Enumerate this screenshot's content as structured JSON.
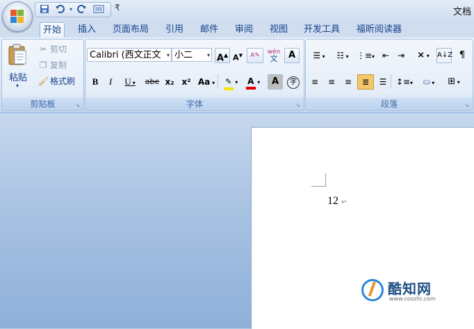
{
  "window": {
    "title": "文档"
  },
  "quick_access": {
    "save_icon": "save-icon",
    "undo_icon": "undo-icon",
    "redo_icon": "redo-icon",
    "print_preview_icon": "print-preview-icon",
    "customize_glyph": "₹"
  },
  "tabs": [
    {
      "label": "开始",
      "active": true
    },
    {
      "label": "插入"
    },
    {
      "label": "页面布局"
    },
    {
      "label": "引用"
    },
    {
      "label": "邮件"
    },
    {
      "label": "审阅"
    },
    {
      "label": "视图"
    },
    {
      "label": "开发工具"
    },
    {
      "label": "福昕阅读器"
    }
  ],
  "clipboard": {
    "group_label": "剪贴板",
    "paste_label": "粘贴",
    "cut_label": "剪切",
    "copy_label": "复制",
    "format_painter_label": "格式刷"
  },
  "font": {
    "group_label": "字体",
    "font_name": "Calibri (西文正文",
    "font_size": "小二",
    "grow_glyph": "A",
    "shrink_glyph": "A",
    "phonetic_glyph": "wén",
    "border_glyph": "A",
    "bold": "B",
    "italic": "I",
    "underline": "U",
    "strike": "abe",
    "subscript": "x₂",
    "superscript": "x²",
    "change_case": "Aa",
    "shading_glyph": "A",
    "enclose_glyph": "字",
    "highlight_color": "#f7e400",
    "font_color": "#e00000"
  },
  "paragraph": {
    "group_label": "段落"
  },
  "document": {
    "text": "12",
    "paragraph_mark": "↵"
  },
  "watermark": {
    "name": "酷知网",
    "url": "www.coozhi.com"
  }
}
